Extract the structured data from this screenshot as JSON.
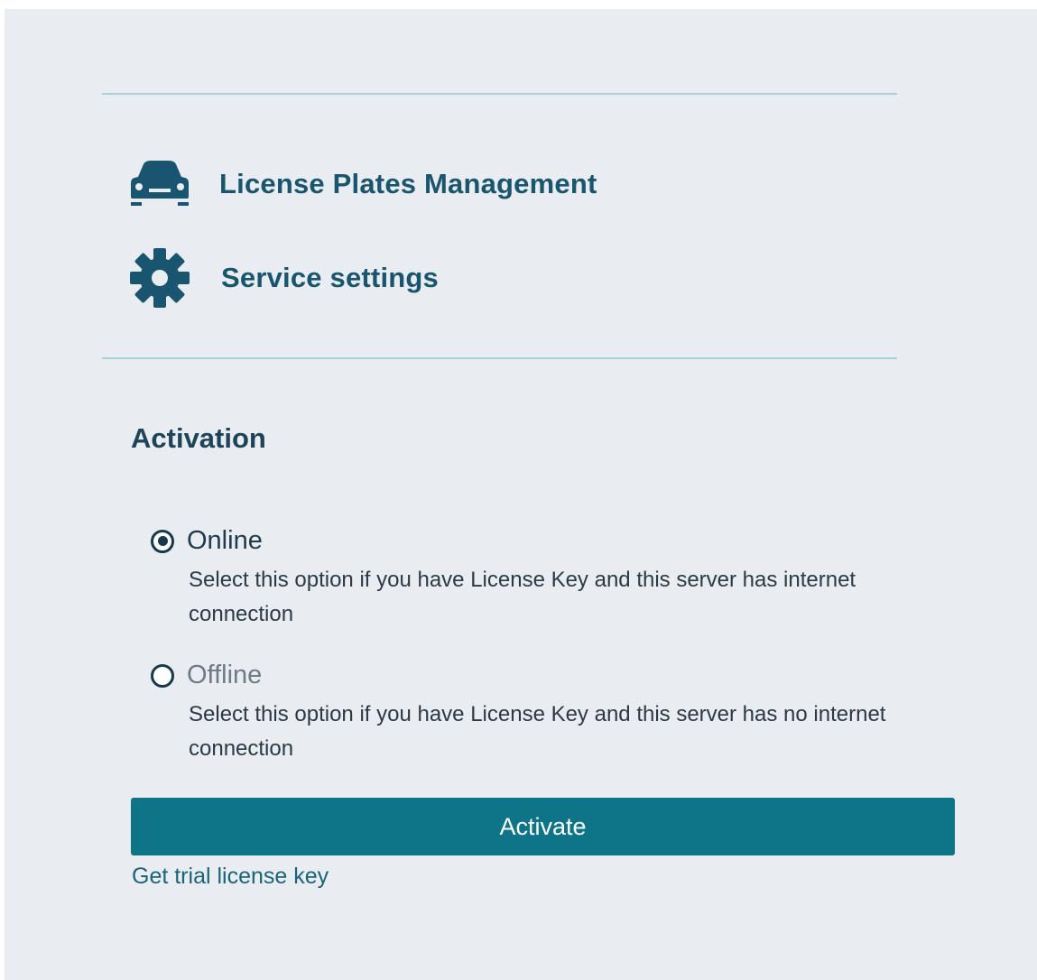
{
  "nav": {
    "items": [
      {
        "label": "License Plates Management",
        "icon": "car-icon"
      },
      {
        "label": "Service settings",
        "icon": "gear-icon"
      }
    ]
  },
  "activation": {
    "title": "Activation",
    "options": [
      {
        "label": "Online",
        "description": "Select this option if you have License Key and this server has internet connection",
        "selected": true
      },
      {
        "label": "Offline",
        "description": "Select this option if you have License Key and this server has no internet connection",
        "selected": false
      }
    ],
    "activate_label": "Activate",
    "trial_link_label": "Get trial license key"
  },
  "colors": {
    "accent": "#0e7589",
    "heading": "#1a5570",
    "panel_background": "#e9edf1",
    "divider": "#a6d2dc"
  }
}
